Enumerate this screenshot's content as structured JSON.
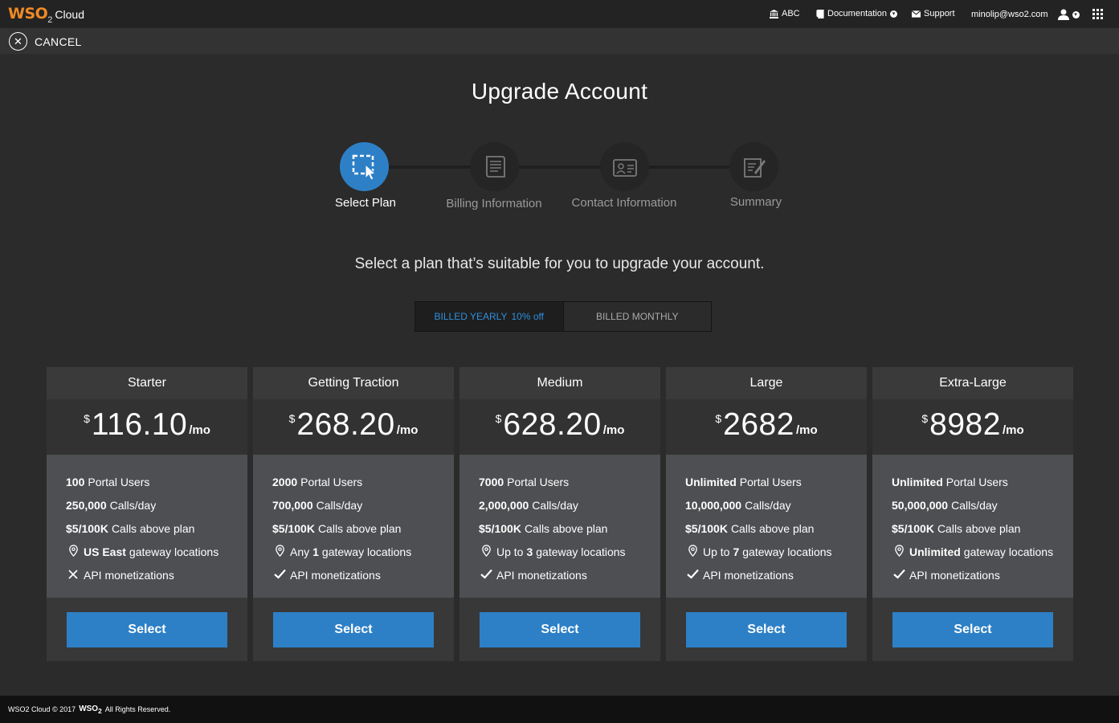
{
  "header": {
    "logo_brand": "WSO",
    "logo_sub": "2",
    "logo_product": "Cloud",
    "org": "ABC",
    "documentation": "Documentation",
    "support": "Support",
    "user_email": "minolip@wso2.com"
  },
  "cancel_label": "CANCEL",
  "page_title": "Upgrade Account",
  "steps": [
    {
      "label": "Select  Plan",
      "icon": "select-plan-icon",
      "active": true
    },
    {
      "label": "Billing Information",
      "icon": "billing-icon",
      "active": false
    },
    {
      "label": "Contact Information",
      "icon": "contact-icon",
      "active": false
    },
    {
      "label": "Summary",
      "icon": "summary-icon",
      "active": false
    }
  ],
  "subtitle": "Select a plan that’s suitable for you to upgrade your account.",
  "billing_toggle": {
    "yearly_label": "BILLED YEARLY",
    "yearly_discount": "10% off",
    "monthly_label": "BILLED MONTHLY",
    "selected": "yearly"
  },
  "plans": [
    {
      "name": "Starter",
      "currency": "$",
      "price": "116.10",
      "period": "/mo",
      "users_bold": "100",
      "users_text": "Portal Users",
      "calls_bold": "250,000",
      "calls_text": "Calls/day",
      "overage_bold": "$5/100K",
      "overage_text": "Calls above plan",
      "gw_prefix": "",
      "gw_bold": "US East",
      "gw_text": "gateway locations",
      "monetization": "API monetizations",
      "monetization_included": false,
      "button": "Select"
    },
    {
      "name": "Getting Traction",
      "currency": "$",
      "price": "268.20",
      "period": "/mo",
      "users_bold": "2000",
      "users_text": "Portal Users",
      "calls_bold": "700,000",
      "calls_text": "Calls/day",
      "overage_bold": "$5/100K",
      "overage_text": "Calls above plan",
      "gw_prefix": "Any",
      "gw_bold": "1",
      "gw_text": "gateway locations",
      "monetization": "API monetizations",
      "monetization_included": true,
      "button": "Select"
    },
    {
      "name": "Medium",
      "currency": "$",
      "price": "628.20",
      "period": "/mo",
      "users_bold": "7000",
      "users_text": "Portal Users",
      "calls_bold": "2,000,000",
      "calls_text": "Calls/day",
      "overage_bold": "$5/100K",
      "overage_text": "Calls above plan",
      "gw_prefix": "Up to",
      "gw_bold": "3",
      "gw_text": "gateway locations",
      "monetization": "API monetizations",
      "monetization_included": true,
      "button": "Select"
    },
    {
      "name": "Large",
      "currency": "$",
      "price": "2682",
      "period": "/mo",
      "users_bold": "Unlimited",
      "users_text": "Portal Users",
      "calls_bold": "10,000,000",
      "calls_text": "Calls/day",
      "overage_bold": "$5/100K",
      "overage_text": "Calls above plan",
      "gw_prefix": "Up to",
      "gw_bold": "7",
      "gw_text": "gateway locations",
      "monetization": "API monetizations",
      "monetization_included": true,
      "button": "Select"
    },
    {
      "name": "Extra-Large",
      "currency": "$",
      "price": "8982",
      "period": "/mo",
      "users_bold": "Unlimited",
      "users_text": "Portal Users",
      "calls_bold": "50,000,000",
      "calls_text": "Calls/day",
      "overage_bold": "$5/100K",
      "overage_text": "Calls above plan",
      "gw_prefix": "",
      "gw_bold": "Unlimited",
      "gw_text": "gateway locations",
      "monetization": "API monetizations",
      "monetization_included": true,
      "button": "Select"
    }
  ],
  "footer": {
    "text_before": "WSO2 Cloud © 2017",
    "logo": "WSO",
    "logo_sub": "2",
    "text_after": "All Rights Reserved."
  },
  "colors": {
    "accent": "#2d80c6",
    "brand_orange": "#f08a24",
    "background": "#2b2b2b"
  }
}
